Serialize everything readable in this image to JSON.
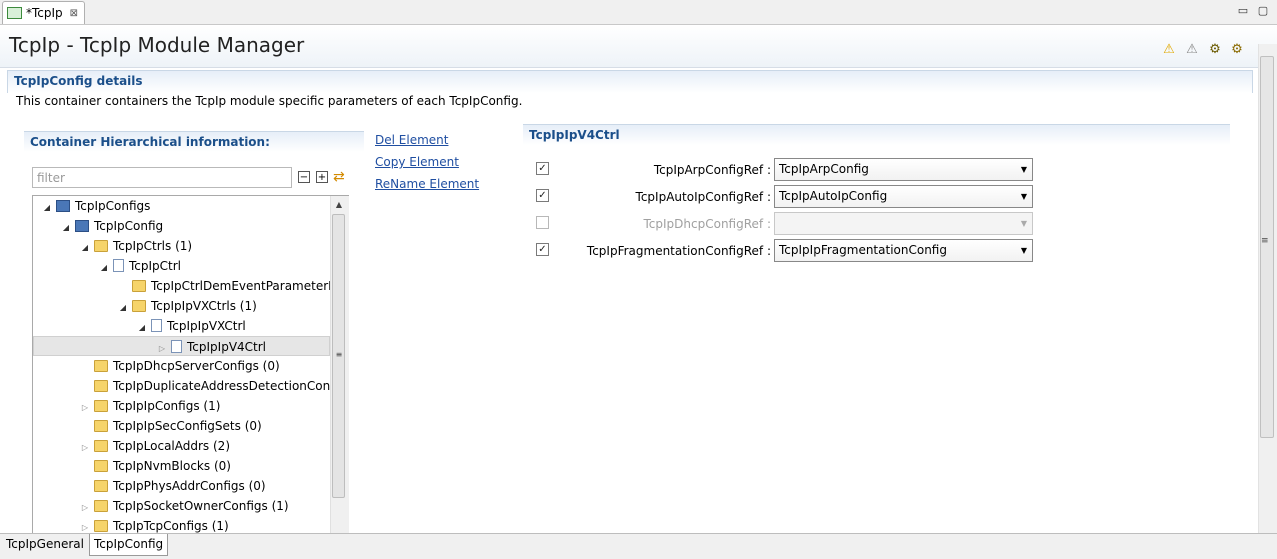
{
  "editor_tab": {
    "label": "*TcpIp",
    "close": "⊠"
  },
  "window_buttons": {
    "minimize": "▭",
    "maximize": "▢"
  },
  "header": {
    "title": "TcpIp - TcpIp Module Manager"
  },
  "toolbar_icons": [
    "warning-yellow-icon",
    "warning-gray-icon",
    "gear-validate-icon",
    "gear-settings-icon"
  ],
  "section": {
    "title": "TcpIpConfig details",
    "description": "This container containers the TcpIp module specific parameters of each TcpIpConfig."
  },
  "hierarchy": {
    "title": "Container Hierarchical information:",
    "filter_placeholder": "filter",
    "tree": [
      {
        "label": "TcpIpConfigs",
        "indent": 0,
        "twisty": "expanded",
        "icon": "module"
      },
      {
        "label": "TcpIpConfig",
        "indent": 1,
        "twisty": "expanded",
        "icon": "module"
      },
      {
        "label": "TcpIpCtrls (1)",
        "indent": 2,
        "twisty": "expanded",
        "icon": "folder"
      },
      {
        "label": "TcpIpCtrl",
        "indent": 3,
        "twisty": "expanded",
        "icon": "doc"
      },
      {
        "label": "TcpIpCtrlDemEventParameterRefs",
        "indent": 4,
        "twisty": "none",
        "icon": "folder"
      },
      {
        "label": "TcpIpIpVXCtrls (1)",
        "indent": 4,
        "twisty": "expanded",
        "icon": "folder"
      },
      {
        "label": "TcpIpIpVXCtrl",
        "indent": 5,
        "twisty": "expanded",
        "icon": "doc"
      },
      {
        "label": "TcpIpIpV4Ctrl",
        "indent": 6,
        "twisty": "collapsed",
        "icon": "doc",
        "selected": true
      },
      {
        "label": "TcpIpDhcpServerConfigs (0)",
        "indent": 2,
        "twisty": "none",
        "icon": "folder"
      },
      {
        "label": "TcpIpDuplicateAddressDetectionConfigs",
        "indent": 2,
        "twisty": "none",
        "icon": "folder"
      },
      {
        "label": "TcpIpIpConfigs (1)",
        "indent": 2,
        "twisty": "collapsed",
        "icon": "folder"
      },
      {
        "label": "TcpIpIpSecConfigSets (0)",
        "indent": 2,
        "twisty": "none",
        "icon": "folder"
      },
      {
        "label": "TcpIpLocalAddrs (2)",
        "indent": 2,
        "twisty": "collapsed",
        "icon": "folder"
      },
      {
        "label": "TcpIpNvmBlocks (0)",
        "indent": 2,
        "twisty": "none",
        "icon": "folder"
      },
      {
        "label": "TcpIpPhysAddrConfigs (0)",
        "indent": 2,
        "twisty": "none",
        "icon": "folder"
      },
      {
        "label": "TcpIpSocketOwnerConfigs (1)",
        "indent": 2,
        "twisty": "collapsed",
        "icon": "folder"
      },
      {
        "label": "TcpIpTcpConfigs (1)",
        "indent": 2,
        "twisty": "collapsed",
        "icon": "folder"
      }
    ]
  },
  "actions": {
    "del": "Del Element",
    "copy": "Copy Element",
    "rename": "ReName Element"
  },
  "detail": {
    "title": "TcpIpIpV4Ctrl",
    "fields": [
      {
        "label": "TcpIpArpConfigRef :",
        "value": "TcpIpArpConfig",
        "checked": true,
        "enabled": true
      },
      {
        "label": "TcpIpAutoIpConfigRef :",
        "value": "TcpIpAutoIpConfig",
        "checked": true,
        "enabled": true
      },
      {
        "label": "TcpIpDhcpConfigRef :",
        "value": "",
        "checked": false,
        "enabled": false
      },
      {
        "label": "TcpIpFragmentationConfigRef :",
        "value": "TcpIpIpFragmentationConfig",
        "checked": true,
        "enabled": true
      }
    ]
  },
  "bottom_tabs": [
    {
      "label": "TcpIpGeneral",
      "active": false
    },
    {
      "label": "TcpIpConfig",
      "active": true
    }
  ],
  "colors": {
    "section_title": "#1b4f8a",
    "link": "#1f4ea1",
    "selection": "#e6e6e6"
  }
}
